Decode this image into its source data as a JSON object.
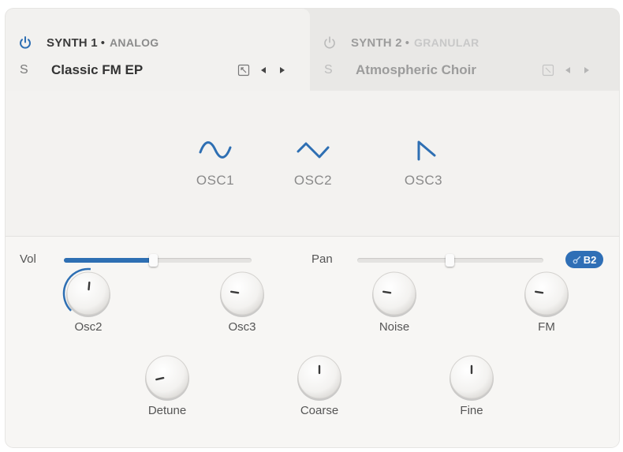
{
  "synth_tabs": [
    {
      "name": "SYNTH 1",
      "separator": "•",
      "type": "ANALOG",
      "solo": "S",
      "preset": "Classic FM EP",
      "active": true
    },
    {
      "name": "SYNTH 2",
      "separator": "•",
      "type": "GRANULAR",
      "solo": "S",
      "preset": "Atmospheric Choir",
      "active": false
    }
  ],
  "oscillators": [
    {
      "label": "OSC1",
      "waveform_icon": "sine-wave-icon"
    },
    {
      "label": "OSC2",
      "waveform_icon": "triangle-wave-icon"
    },
    {
      "label": "OSC3",
      "waveform_icon": "saw-wave-icon"
    }
  ],
  "vol": {
    "label": "Vol",
    "level": 0.48
  },
  "pan": {
    "label": "Pan",
    "level": 0.5
  },
  "badge": {
    "text": "B2",
    "icon": "link-icon"
  },
  "knobs": [
    {
      "label": "Osc2",
      "value": 0.52,
      "arc": true
    },
    {
      "label": "Osc3",
      "value": 0.2
    },
    {
      "label": "Noise",
      "value": 0.2
    },
    {
      "label": "FM",
      "value": 0.2
    },
    {
      "label": "Detune",
      "value": 0.12
    },
    {
      "label": "Coarse",
      "value": 0.5
    },
    {
      "label": "Fine",
      "value": 0.5
    }
  ],
  "colors": {
    "accent": "#2e6fb3",
    "background": "#f2f1ef",
    "inactive_tab": "#e9e8e6"
  }
}
